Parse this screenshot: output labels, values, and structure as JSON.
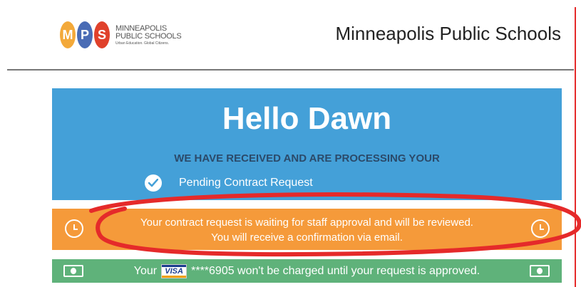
{
  "header": {
    "logo": {
      "letters": [
        {
          "char": "M",
          "color": "#f3a93a"
        },
        {
          "char": "P",
          "color": "#4a6cb5"
        },
        {
          "char": "S",
          "color": "#e0412b"
        }
      ],
      "name_line1": "MINNEAPOLIS",
      "name_line2": "PUBLIC SCHOOLS",
      "tagline": "Urban Education. Global Citizens."
    },
    "title": "Minneapolis Public Schools"
  },
  "greeting": {
    "hello": "Hello Dawn",
    "processing": "WE HAVE RECEIVED AND ARE PROCESSING YOUR",
    "pending_label": "Pending Contract Request",
    "icon": "check-circle-icon"
  },
  "approval_notice": {
    "line1": "Your contract request is waiting for staff approval and will be reviewed.",
    "line2": "You will receive a confirmation via email.",
    "icon": "clock-icon"
  },
  "payment_notice": {
    "prefix": "Your",
    "card_brand": "VISA",
    "suffix": "****6905 won't be charged until your request is approved.",
    "icon": "money-bill-icon"
  },
  "colors": {
    "blue": "#44a0d8",
    "orange": "#f59a3a",
    "green": "#5fb27a",
    "annotation_red": "#e52a2a"
  }
}
